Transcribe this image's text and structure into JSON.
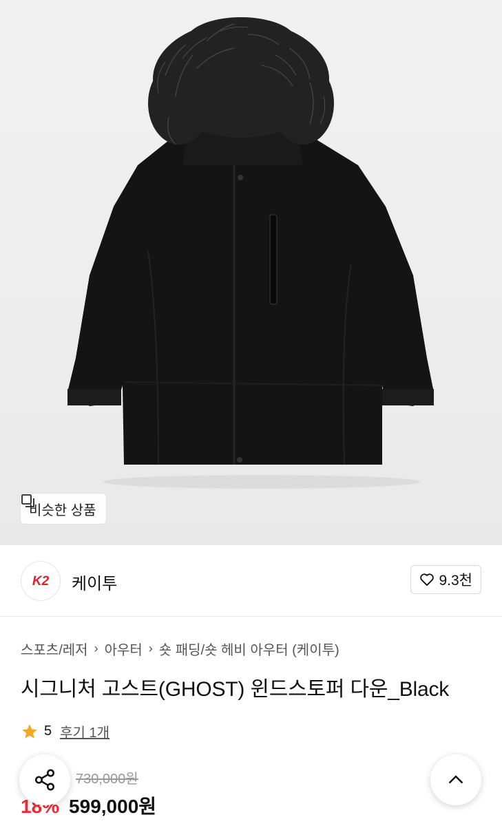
{
  "hero": {
    "similar_button_label": "비슷한 상품"
  },
  "brand": {
    "logo_text": "K2",
    "name": "케이투",
    "like_count": "9.3천"
  },
  "breadcrumb": [
    "스포츠/레저",
    "아우터",
    "숏 패딩/숏 헤비 아우터 (케이투)"
  ],
  "product": {
    "title": "시그니처 고스트(GHOST) 윈드스토퍼 다운_Black",
    "rating": "5",
    "reviews": "후기 1개",
    "original_price": "730,000원",
    "discount": "18%",
    "price": "599,000원"
  },
  "colors": {
    "discount": "#ee2b36",
    "logo_red": "#d7262f",
    "star": "#f5a623"
  },
  "icons": [
    "similar-items-icon",
    "heart-icon",
    "star-icon",
    "share-icon",
    "chevron-up-icon"
  ]
}
